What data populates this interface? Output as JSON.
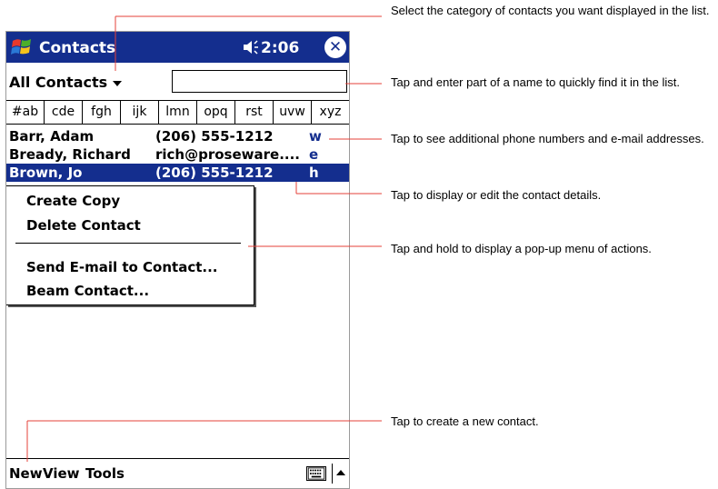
{
  "device": {
    "app_title": "Contacts",
    "clock": "2:06",
    "close_symbol": "✕",
    "category": "All Contacts",
    "search": {
      "value": "",
      "placeholder": ""
    },
    "tabs": [
      "#ab",
      "cde",
      "fgh",
      "ijk",
      "lmn",
      "opq",
      "rst",
      "uvw",
      "xyz"
    ],
    "contacts": [
      {
        "name": "Barr, Adam",
        "detail": "(206) 555-1212",
        "type": "w"
      },
      {
        "name": "Bready, Richard",
        "detail": "rich@proseware....",
        "type": "e"
      },
      {
        "name": "Brown, Jo",
        "detail": "(206) 555-1212",
        "type": "h"
      }
    ],
    "popup_menu": {
      "items": [
        "Create Copy",
        "Delete Contact",
        "Send E-mail to Contact...",
        "Beam Contact..."
      ]
    },
    "menu_bar": {
      "new": "New",
      "view": "View",
      "tools": "Tools"
    }
  },
  "callouts": [
    "Select the category of contacts you want displayed in the list.",
    "Tap and enter part of a name to quickly find it in the list.",
    "Tap to see additional phone numbers and e-mail addresses.",
    "Tap to display or edit the contact details.",
    "Tap and hold to display a pop-up menu of actions.",
    "Tap to create a new contact."
  ],
  "colors": {
    "title_bar": "#142e8e",
    "selection": "#142e8e",
    "callout_line": "#e5403a"
  },
  "icons": [
    "windows-logo-icon",
    "speaker-icon",
    "close-icon",
    "chevron-down-icon",
    "keyboard-icon",
    "arrow-up-icon"
  ]
}
